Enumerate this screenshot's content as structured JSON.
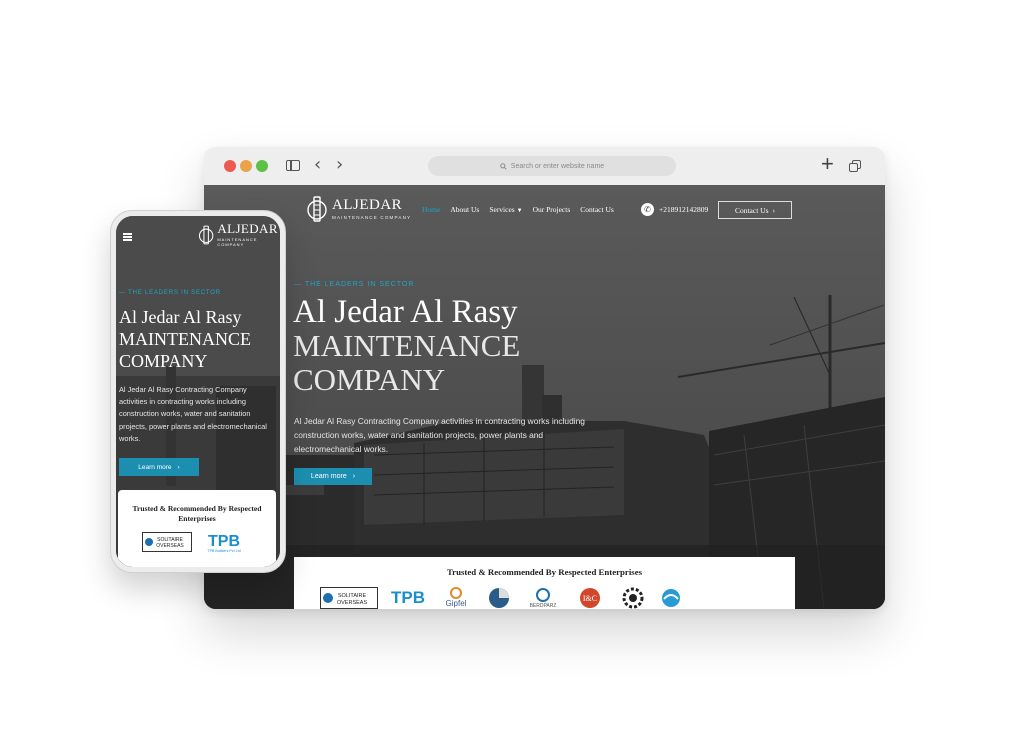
{
  "browser": {
    "address_placeholder": "Search or enter website name",
    "traffic_lights": [
      "#ee5a52",
      "#e9a34a",
      "#5fc046"
    ]
  },
  "site": {
    "brand": {
      "name": "ALJEDAR",
      "tagline": "MAINTENANCE COMPANY"
    },
    "nav": {
      "home": "Home",
      "about": "About Us",
      "services": "Services",
      "projects": "Our Projects",
      "contact": "Contact Us"
    },
    "phone": "+218912142809",
    "contact_button": "Contact Us",
    "hero": {
      "eyebrow": "— THE LEADERS IN SECTOR",
      "title_line1": "Al Jedar Al Rasy",
      "title_line2": "MAINTENANCE",
      "title_line3": "COMPANY",
      "description": "Al Jedar Al Rasy Contracting Company activities in contracting works including construction works, water and sanitation projects, power plants and electromechanical works.",
      "cta": "Learn more"
    },
    "trusted": {
      "title": "Trusted & Recommended By Respected Enterprises",
      "clients": [
        "SOLITAIRE OVERSEAS",
        "TPB",
        "Gipfel",
        "BERDPARZ",
        "I&C"
      ]
    },
    "accent_color": "#1ca6c8"
  },
  "mobile": {
    "eyebrow": "— THE LEADERS IN SECTOR",
    "title_line1": "Al Jedar Al Rasy",
    "title_line2": "MAINTENANCE",
    "title_line3": "COMPANY",
    "description": "Al Jedar Al Rasy Contracting Company activities in contracting works including construction works, water and sanitation projects, power plants and electromechanical works.",
    "cta": "Learn more",
    "trusted_title": "Trusted & Recommended By Respected Enterprises",
    "clients": [
      "SOLITAIRE OVERSEAS",
      "TPB",
      "TPB Builders Pvt Ltd"
    ]
  }
}
